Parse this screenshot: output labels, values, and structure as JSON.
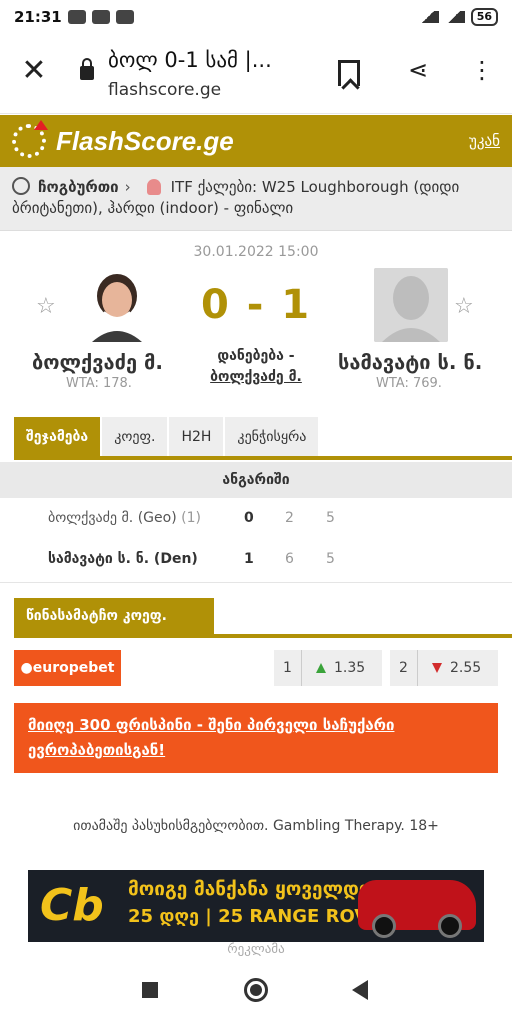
{
  "status_bar": {
    "time": "21:31",
    "battery": "56"
  },
  "browser": {
    "title": "ბოლ 0-1 სამ |...",
    "host": "flashscore.ge"
  },
  "header": {
    "logo_text": "FlashScore.ge",
    "back_label": "უკან"
  },
  "breadcrumb": {
    "sport": "ჩოგბურთი",
    "tournament": "ITF ქალები: W25 Loughborough (დიდი ბრიტანეთი), ჰარდი (indoor) - ფინალი"
  },
  "match": {
    "datetime": "30.01.2022 15:00",
    "score": "0 - 1",
    "result_label": "დანებება -",
    "result_player": "ბოლქვაძე მ.",
    "home": {
      "name": "ბოლქვაძე მ.",
      "rank": "WTA: 178."
    },
    "away": {
      "name": "სამავატი ს. ნ.",
      "rank": "WTA: 769."
    }
  },
  "tabs": [
    {
      "label": "შეჯამება"
    },
    {
      "label": "კოეფ."
    },
    {
      "label": "H2H"
    },
    {
      "label": "კენჭისყრა"
    }
  ],
  "scoreboard": {
    "heading": "ანგარიში",
    "rows": [
      {
        "player": "ბოლქვაძე მ. (Geo)",
        "seed": "(1)",
        "sets": "0",
        "s1": "2",
        "s2": "5"
      },
      {
        "player": "სამავატი ს. ნ. (Den)",
        "seed": "",
        "sets": "1",
        "s1": "6",
        "s2": "5"
      }
    ]
  },
  "odds": {
    "tab_label": "წინასამატჩო კოეფ.",
    "bookie": "europebet",
    "home_label": "1",
    "home_value": "1.35",
    "home_trend": "up",
    "away_label": "2",
    "away_value": "2.55",
    "away_trend": "down"
  },
  "promo": {
    "text": "მიიღე 300 ფრისპინი - შენი პირველი საჩუქარი ევროპაბეთისგან!"
  },
  "responsible_text": "ითამაშე პასუხისმგებლობით. Gambling Therapy. 18+",
  "ad": {
    "logo": "Cb",
    "line1": "მოიგე მანქანა ყოველდღე",
    "line2": "25 დღე | 25 RANGE ROVER",
    "label": "რეკლამა"
  },
  "colors": {
    "brand": "#b09107",
    "promo": "#f0561c",
    "up": "#3aa33a",
    "down": "#d22c2c"
  }
}
